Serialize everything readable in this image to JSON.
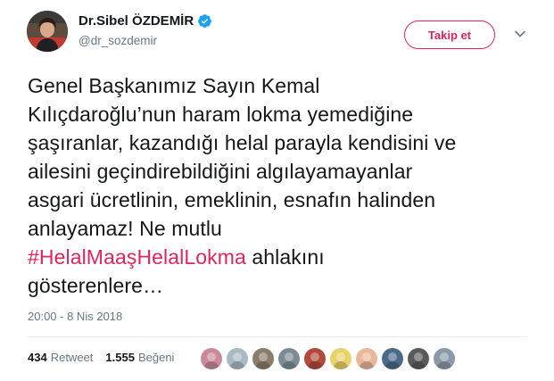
{
  "author": {
    "display_name": "Dr.Sibel ÖZDEMİR",
    "handle": "@dr_sozdemir",
    "verified_color": "#1da1f2"
  },
  "follow_button": {
    "label": "Takip et",
    "color": "#e0245e"
  },
  "tweet": {
    "lines": [
      "Genel Başkanımız Sayın Kemal",
      "Kılıçdaroğlu’nun haram lokma yemediğine",
      "şaşıranlar, kazandığı helal parayla kendisini ve",
      "ailesini geçindirebildiğini algılayamayanlar",
      "asgari ücretlinin, emeklinin, esnafın halinden",
      "anlayamaz! Ne mutlu"
    ],
    "hashtag": "#HelalMaaşHelalLokma",
    "after_hashtag": " ahlakını",
    "last_line": "gösterenlere…",
    "hashtag_color": "#e0245e"
  },
  "timestamp": "20:00 - 8 Nis 2018",
  "stats": {
    "retweets_count": "434",
    "retweets_label": "Retweet",
    "likes_count": "1.555",
    "likes_label": "Beğeni"
  },
  "likers": [
    {
      "name": "liker-avatar-1",
      "color": "#c98a9a"
    },
    {
      "name": "liker-avatar-2",
      "color": "#aab8c2"
    },
    {
      "name": "liker-avatar-3",
      "color": "#8a7d6a"
    },
    {
      "name": "liker-avatar-4",
      "color": "#7a8b94"
    },
    {
      "name": "liker-avatar-5",
      "color": "#b04a3a"
    },
    {
      "name": "liker-avatar-6",
      "color": "#e8d36a"
    },
    {
      "name": "liker-avatar-7",
      "color": "#e9b79a"
    },
    {
      "name": "liker-avatar-8",
      "color": "#4a6a8a"
    },
    {
      "name": "liker-avatar-9",
      "color": "#5a5a5a"
    },
    {
      "name": "liker-avatar-10",
      "color": "#8a9aa8"
    }
  ]
}
